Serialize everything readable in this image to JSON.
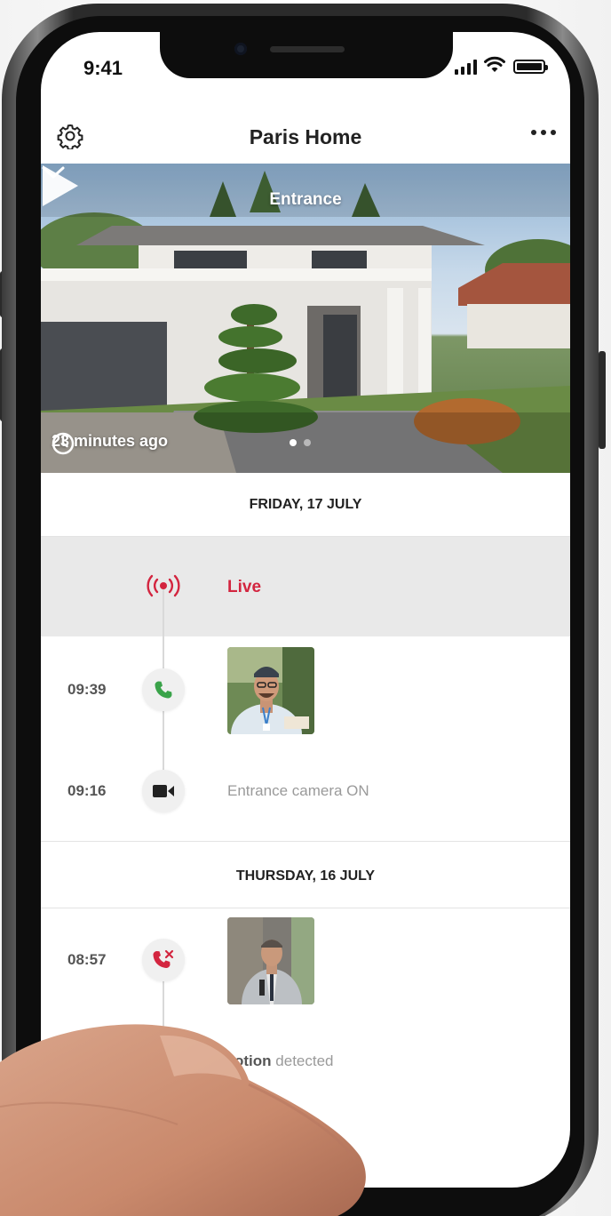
{
  "status_bar": {
    "time": "9:41"
  },
  "header": {
    "title": "Paris Home"
  },
  "hero": {
    "camera_name": "Entrance",
    "last_update": "23 minutes ago",
    "pages": 2,
    "active_page": 1
  },
  "timeline": {
    "days": [
      {
        "label": "FRIDAY, 17 JULY",
        "events": [
          {
            "time": "",
            "type": "live",
            "icon": "live-broadcast-icon",
            "label": "Live"
          },
          {
            "time": "09:39",
            "type": "call-answered",
            "icon": "phone-icon",
            "label": ""
          },
          {
            "time": "09:16",
            "type": "camera-on",
            "icon": "video-camera-icon",
            "label": "Entrance camera ON"
          }
        ]
      },
      {
        "label": "THURSDAY, 16 JULY",
        "events": [
          {
            "time": "08:57",
            "type": "call-missed",
            "icon": "missed-call-icon",
            "label": ""
          },
          {
            "time": "",
            "type": "motion",
            "icon": "motion-icon",
            "label_visible": "otion",
            "label_detail": "detected"
          }
        ]
      }
    ]
  },
  "colors": {
    "accent_red": "#d3253f",
    "call_green": "#3aa34a"
  }
}
